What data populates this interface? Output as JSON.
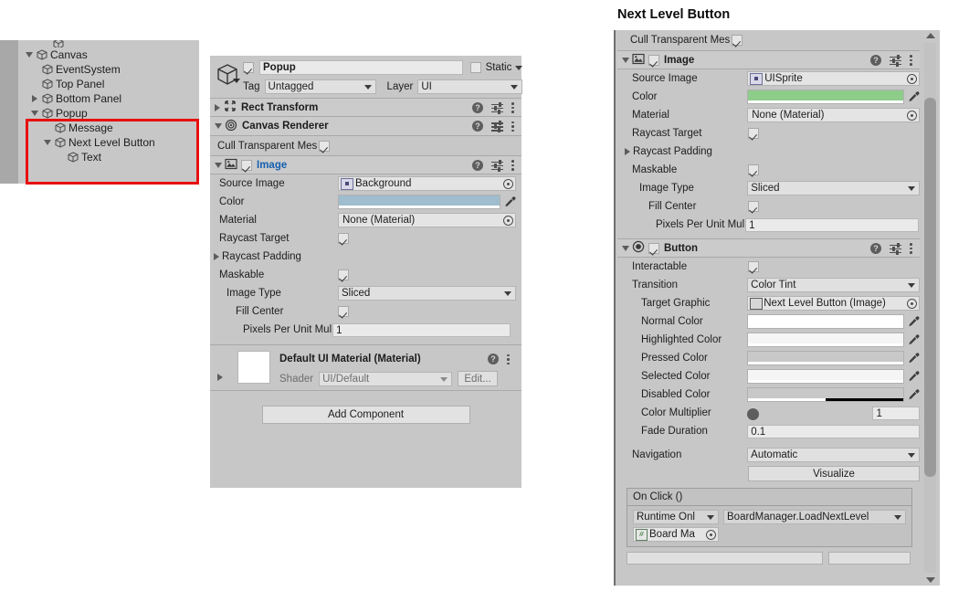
{
  "hierarchy": {
    "rows": [
      {
        "label": "",
        "indent": 2,
        "fold": "none",
        "cut": true
      },
      {
        "label": "Canvas",
        "indent": 2,
        "fold": "down"
      },
      {
        "label": "EventSystem",
        "indent": 3,
        "fold": "none"
      },
      {
        "label": "Top Panel",
        "indent": 3,
        "fold": "none"
      },
      {
        "label": "Bottom Panel",
        "indent": 3,
        "fold": "right"
      },
      {
        "label": "Popup",
        "indent": 3,
        "fold": "down"
      },
      {
        "label": "Message",
        "indent": 4,
        "fold": "none"
      },
      {
        "label": "Next Level Button",
        "indent": 4,
        "fold": "down"
      },
      {
        "label": "Text",
        "indent": 5,
        "fold": "none"
      }
    ],
    "highlight_color": "#e81010"
  },
  "inspector_popup": {
    "name_value": "Popup",
    "name_enabled": true,
    "static_label": "Static",
    "static_checked": false,
    "tag_label": "Tag",
    "tag_value": "Untagged",
    "layer_label": "Layer",
    "layer_value": "UI",
    "components": [
      {
        "title": "Rect Transform",
        "expanded": false,
        "icon": "rect-transform-icon"
      },
      {
        "title": "Canvas Renderer",
        "expanded": true,
        "icon": "canvas-renderer-icon"
      }
    ],
    "cull_transparent_label": "Cull Transparent Mes",
    "cull_transparent_checked": true,
    "image": {
      "title": "Image",
      "enabled": true,
      "source_image_label": "Source Image",
      "source_image_value": "Background",
      "color_label": "Color",
      "color_value": "#9fbdce",
      "color_alpha_pct": 100,
      "material_label": "Material",
      "material_value": "None (Material)",
      "raycast_target_label": "Raycast Target",
      "raycast_target_checked": true,
      "raycast_padding_label": "Raycast Padding",
      "maskable_label": "Maskable",
      "maskable_checked": true,
      "image_type_label": "Image Type",
      "image_type_value": "Sliced",
      "fill_center_label": "Fill Center",
      "fill_center_checked": true,
      "pixels_label": "Pixels Per Unit Mul",
      "pixels_value": "1"
    },
    "material_block": {
      "title": "Default UI Material (Material)",
      "shader_label": "Shader",
      "shader_value": "UI/Default",
      "edit_label": "Edit..."
    },
    "add_component_label": "Add Component"
  },
  "inspector_button": {
    "page_title": "Next Level Button",
    "cull_transparent_label": "Cull Transparent Mes",
    "cull_transparent_checked": true,
    "image": {
      "title": "Image",
      "enabled": true,
      "source_image_label": "Source Image",
      "source_image_value": "UISprite",
      "color_label": "Color",
      "color_value": "#8ecc8a",
      "material_label": "Material",
      "material_value": "None (Material)",
      "raycast_target_label": "Raycast Target",
      "raycast_target_checked": true,
      "raycast_padding_label": "Raycast Padding",
      "maskable_label": "Maskable",
      "maskable_checked": true,
      "image_type_label": "Image Type",
      "image_type_value": "Sliced",
      "fill_center_label": "Fill Center",
      "fill_center_checked": true,
      "pixels_label": "Pixels Per Unit Mul",
      "pixels_value": "1"
    },
    "button": {
      "title": "Button",
      "enabled": true,
      "interactable_label": "Interactable",
      "interactable_checked": true,
      "transition_label": "Transition",
      "transition_value": "Color Tint",
      "target_graphic_label": "Target Graphic",
      "target_graphic_value": "Next Level Button (Image)",
      "normal_color_label": "Normal Color",
      "normal_color_value": "#ffffff",
      "highlighted_color_label": "Highlighted Color",
      "highlighted_color_value": "#f5f5f5",
      "pressed_color_label": "Pressed Color",
      "pressed_color_value": "#c8c8c8",
      "selected_color_label": "Selected Color",
      "selected_color_value": "#f5f5f5",
      "disabled_color_label": "Disabled Color",
      "disabled_color_value": "#c8c8c8",
      "disabled_alpha_pct": 50,
      "color_multiplier_label": "Color Multiplier",
      "color_multiplier_value": "1",
      "fade_duration_label": "Fade Duration",
      "fade_duration_value": "0.1",
      "navigation_label": "Navigation",
      "navigation_value": "Automatic",
      "visualize_label": "Visualize"
    },
    "on_click": {
      "title": "On Click ()",
      "runtime_value": "Runtime Onl",
      "function_value": "BoardManager.LoadNextLevel",
      "object_value": "Board Ma"
    }
  }
}
